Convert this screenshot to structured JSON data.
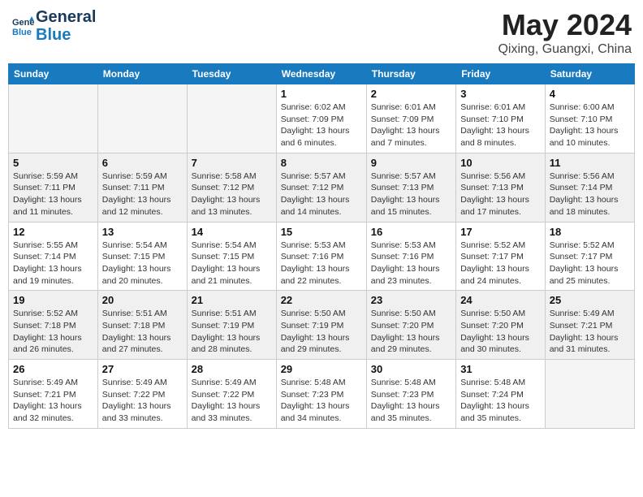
{
  "logo": {
    "line1": "General",
    "line2": "Blue"
  },
  "title": "May 2024",
  "location": "Qixing, Guangxi, China",
  "weekdays": [
    "Sunday",
    "Monday",
    "Tuesday",
    "Wednesday",
    "Thursday",
    "Friday",
    "Saturday"
  ],
  "weeks": [
    [
      {
        "day": "",
        "info": ""
      },
      {
        "day": "",
        "info": ""
      },
      {
        "day": "",
        "info": ""
      },
      {
        "day": "1",
        "info": "Sunrise: 6:02 AM\nSunset: 7:09 PM\nDaylight: 13 hours and 6 minutes."
      },
      {
        "day": "2",
        "info": "Sunrise: 6:01 AM\nSunset: 7:09 PM\nDaylight: 13 hours and 7 minutes."
      },
      {
        "day": "3",
        "info": "Sunrise: 6:01 AM\nSunset: 7:10 PM\nDaylight: 13 hours and 8 minutes."
      },
      {
        "day": "4",
        "info": "Sunrise: 6:00 AM\nSunset: 7:10 PM\nDaylight: 13 hours and 10 minutes."
      }
    ],
    [
      {
        "day": "5",
        "info": "Sunrise: 5:59 AM\nSunset: 7:11 PM\nDaylight: 13 hours and 11 minutes."
      },
      {
        "day": "6",
        "info": "Sunrise: 5:59 AM\nSunset: 7:11 PM\nDaylight: 13 hours and 12 minutes."
      },
      {
        "day": "7",
        "info": "Sunrise: 5:58 AM\nSunset: 7:12 PM\nDaylight: 13 hours and 13 minutes."
      },
      {
        "day": "8",
        "info": "Sunrise: 5:57 AM\nSunset: 7:12 PM\nDaylight: 13 hours and 14 minutes."
      },
      {
        "day": "9",
        "info": "Sunrise: 5:57 AM\nSunset: 7:13 PM\nDaylight: 13 hours and 15 minutes."
      },
      {
        "day": "10",
        "info": "Sunrise: 5:56 AM\nSunset: 7:13 PM\nDaylight: 13 hours and 17 minutes."
      },
      {
        "day": "11",
        "info": "Sunrise: 5:56 AM\nSunset: 7:14 PM\nDaylight: 13 hours and 18 minutes."
      }
    ],
    [
      {
        "day": "12",
        "info": "Sunrise: 5:55 AM\nSunset: 7:14 PM\nDaylight: 13 hours and 19 minutes."
      },
      {
        "day": "13",
        "info": "Sunrise: 5:54 AM\nSunset: 7:15 PM\nDaylight: 13 hours and 20 minutes."
      },
      {
        "day": "14",
        "info": "Sunrise: 5:54 AM\nSunset: 7:15 PM\nDaylight: 13 hours and 21 minutes."
      },
      {
        "day": "15",
        "info": "Sunrise: 5:53 AM\nSunset: 7:16 PM\nDaylight: 13 hours and 22 minutes."
      },
      {
        "day": "16",
        "info": "Sunrise: 5:53 AM\nSunset: 7:16 PM\nDaylight: 13 hours and 23 minutes."
      },
      {
        "day": "17",
        "info": "Sunrise: 5:52 AM\nSunset: 7:17 PM\nDaylight: 13 hours and 24 minutes."
      },
      {
        "day": "18",
        "info": "Sunrise: 5:52 AM\nSunset: 7:17 PM\nDaylight: 13 hours and 25 minutes."
      }
    ],
    [
      {
        "day": "19",
        "info": "Sunrise: 5:52 AM\nSunset: 7:18 PM\nDaylight: 13 hours and 26 minutes."
      },
      {
        "day": "20",
        "info": "Sunrise: 5:51 AM\nSunset: 7:18 PM\nDaylight: 13 hours and 27 minutes."
      },
      {
        "day": "21",
        "info": "Sunrise: 5:51 AM\nSunset: 7:19 PM\nDaylight: 13 hours and 28 minutes."
      },
      {
        "day": "22",
        "info": "Sunrise: 5:50 AM\nSunset: 7:19 PM\nDaylight: 13 hours and 29 minutes."
      },
      {
        "day": "23",
        "info": "Sunrise: 5:50 AM\nSunset: 7:20 PM\nDaylight: 13 hours and 29 minutes."
      },
      {
        "day": "24",
        "info": "Sunrise: 5:50 AM\nSunset: 7:20 PM\nDaylight: 13 hours and 30 minutes."
      },
      {
        "day": "25",
        "info": "Sunrise: 5:49 AM\nSunset: 7:21 PM\nDaylight: 13 hours and 31 minutes."
      }
    ],
    [
      {
        "day": "26",
        "info": "Sunrise: 5:49 AM\nSunset: 7:21 PM\nDaylight: 13 hours and 32 minutes."
      },
      {
        "day": "27",
        "info": "Sunrise: 5:49 AM\nSunset: 7:22 PM\nDaylight: 13 hours and 33 minutes."
      },
      {
        "day": "28",
        "info": "Sunrise: 5:49 AM\nSunset: 7:22 PM\nDaylight: 13 hours and 33 minutes."
      },
      {
        "day": "29",
        "info": "Sunrise: 5:48 AM\nSunset: 7:23 PM\nDaylight: 13 hours and 34 minutes."
      },
      {
        "day": "30",
        "info": "Sunrise: 5:48 AM\nSunset: 7:23 PM\nDaylight: 13 hours and 35 minutes."
      },
      {
        "day": "31",
        "info": "Sunrise: 5:48 AM\nSunset: 7:24 PM\nDaylight: 13 hours and 35 minutes."
      },
      {
        "day": "",
        "info": ""
      }
    ]
  ]
}
